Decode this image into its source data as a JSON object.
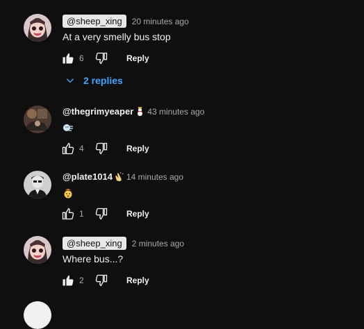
{
  "comments": [
    {
      "author": "@sheep_xing",
      "author_is_chip": true,
      "time": "20 minutes ago",
      "text": "At a very smelly bus stop",
      "likes": "6",
      "liked": true,
      "reply_label": "Reply",
      "replies_label": "2 replies"
    },
    {
      "author": "@thegrimyeaper",
      "badge_icon": "snowman-icon",
      "time": "43 minutes ago",
      "emoji_icon": "wind-face-emoji",
      "likes": "4",
      "liked": false,
      "reply_label": "Reply"
    },
    {
      "author": "@plate1014",
      "badge_icon": "clapping-hands-icon",
      "time": "14 minutes ago",
      "emoji_icon": "exploding-head-emoji",
      "likes": "1",
      "liked": false,
      "reply_label": "Reply"
    },
    {
      "author": "@sheep_xing",
      "author_is_chip": true,
      "time": "2 minutes ago",
      "text": "Where bus...?",
      "likes": "2",
      "liked": true,
      "reply_label": "Reply"
    }
  ],
  "colors": {
    "background": "#0f0f0f",
    "text": "#f1f1f1",
    "secondary_text": "#aaaaaa",
    "link": "#3ea6ff",
    "author_chip_bg": "#e8e8e8"
  }
}
